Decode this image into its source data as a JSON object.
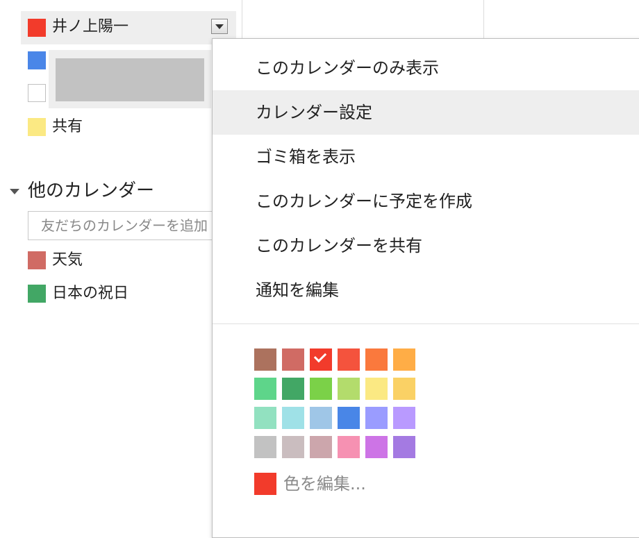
{
  "colors": {
    "selected_row_bg": "#eeeeee",
    "divider": "#dcdcdc",
    "right_blue": "#4a7bd8",
    "right_red": "#ea4335"
  },
  "sidebar": {
    "my_calendars": [
      {
        "label": "井ノ上陽一",
        "color": "#f23b2b"
      },
      {
        "label": "",
        "color": "#4a86e8"
      },
      {
        "label": "",
        "color": ""
      },
      {
        "label": "共有",
        "color": "#fbe983"
      }
    ],
    "dropdown_icon": "chevron-down-icon",
    "other_section": {
      "title": "他のカレンダー",
      "toggle_icon": "triangle-down-icon",
      "input": {
        "value": "",
        "placeholder": "友だちのカレンダーを追加"
      },
      "items": [
        {
          "label": "天気",
          "color": "#d06b64"
        },
        {
          "label": "日本の祝日",
          "color": "#42a765"
        }
      ]
    }
  },
  "menu": {
    "items": [
      {
        "label": "このカレンダーのみ表示",
        "active": false
      },
      {
        "label": "カレンダー設定",
        "active": true
      },
      {
        "label": "ゴミ箱を表示",
        "active": false
      },
      {
        "label": "このカレンダーに予定を作成",
        "active": false
      },
      {
        "label": "このカレンダーを共有",
        "active": false
      },
      {
        "label": "通知を編集",
        "active": false
      }
    ],
    "palette": [
      [
        "#ac725e",
        "#d06b64",
        "#f23b2b",
        "#f4533d",
        "#fa793d",
        "#ffad46"
      ],
      [
        "#5ed58a",
        "#42a765",
        "#7bd148",
        "#b3dc6c",
        "#fbe983",
        "#fad165"
      ],
      [
        "#92e1c0",
        "#9fe1e7",
        "#9fc6e7",
        "#4986e7",
        "#9a9cff",
        "#b99aff"
      ],
      [
        "#c2c2c2",
        "#cabdbf",
        "#cca6ac",
        "#f691b2",
        "#cd74e6",
        "#a47ae2"
      ]
    ],
    "selected_color": "#f23b2b",
    "selected_icon": "check-icon",
    "edit_color": {
      "label": "色を編集...",
      "color": "#f23b2b"
    }
  }
}
